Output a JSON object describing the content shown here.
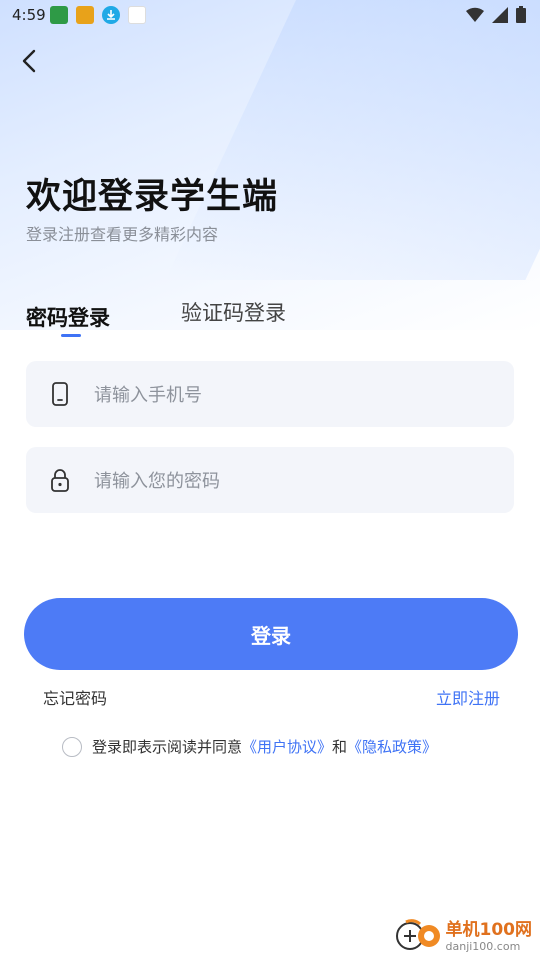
{
  "status_bar": {
    "time": "4:59",
    "notification_icons": [
      "app-icon-1",
      "app-icon-2",
      "download-icon",
      "app-icon-3"
    ],
    "right_icons": [
      "wifi-icon",
      "signal-icon",
      "battery-icon"
    ]
  },
  "header": {
    "title": "欢迎登录学生端",
    "subtitle": "登录注册查看更多精彩内容"
  },
  "tabs": [
    {
      "label": "密码登录",
      "active": true
    },
    {
      "label": "验证码登录",
      "active": false
    }
  ],
  "form": {
    "phone_placeholder": "请输入手机号",
    "phone_value": "",
    "password_placeholder": "请输入您的密码",
    "password_value": "",
    "login_label": "登录"
  },
  "links": {
    "forgot": "忘记密码",
    "register": "立即注册"
  },
  "agreement": {
    "text": "登录即表示阅读并同意",
    "user_agreement": "《用户协议》",
    "and": "和",
    "privacy": "《隐私政策》"
  },
  "watermark": {
    "title": "单机100网",
    "url": "danji100.com"
  },
  "colors": {
    "accent": "#4d7bf6",
    "link": "#3f73f5"
  }
}
